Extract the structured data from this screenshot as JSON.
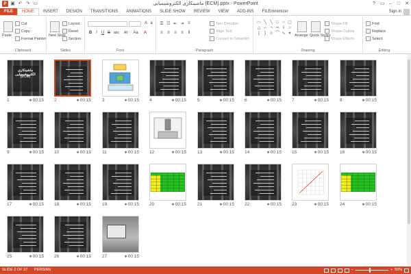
{
  "app": {
    "title": "ماشینکاری الکتروشیمیایی (ECM).pptx - PowerPoint",
    "icon_letter": "P"
  },
  "window": {
    "help": "?",
    "minimize": "–",
    "restore": "□",
    "close": "✕"
  },
  "qat": [
    "save-icon",
    "undo-icon",
    "redo-icon",
    "start-from-beginning-icon"
  ],
  "tabs": [
    {
      "label": "FILE"
    },
    {
      "label": "HOME"
    },
    {
      "label": "INSERT"
    },
    {
      "label": "DESIGN"
    },
    {
      "label": "TRANSITIONS"
    },
    {
      "label": "ANIMATIONS"
    },
    {
      "label": "SLIDE SHOW"
    },
    {
      "label": "REVIEW"
    },
    {
      "label": "VIEW"
    },
    {
      "label": "ADD-INS"
    },
    {
      "label": "FILEminimizer"
    }
  ],
  "account": {
    "signin": "Sign in"
  },
  "ribbon": {
    "clipboard": {
      "label": "Clipboard",
      "paste": "Paste",
      "cut": "Cut",
      "copy": "Copy",
      "format_painter": "Format Painter"
    },
    "slides": {
      "label": "Slides",
      "new_slide": "New Slide",
      "layout": "Layout",
      "reset": "Reset",
      "section": "Section"
    },
    "font": {
      "label": "Font",
      "bold": "B",
      "italic": "I",
      "underline": "U",
      "strike": "S",
      "abc": "abc",
      "av": "AV",
      "aa": "Aa",
      "fontcolor": "A"
    },
    "paragraph": {
      "label": "Paragraph",
      "text_direction": "Text Direction",
      "align_text": "Align Text",
      "convert_smartart": "Convert to SmartArt"
    },
    "drawing": {
      "label": "Drawing",
      "arrange": "Arrange",
      "quick_styles": "Quick Styles",
      "shape_fill": "Shape Fill",
      "shape_outline": "Shape Outline",
      "shape_effects": "Shape Effects"
    },
    "editing": {
      "label": "Editing",
      "find": "Find",
      "replace": "Replace",
      "select": "Select"
    }
  },
  "slides": [
    {
      "num": "1",
      "time": "00:15",
      "kind": "title",
      "title": "ماشینکاری الکتروشیمیایی",
      "subtitle": "(ECM)"
    },
    {
      "num": "2",
      "time": "00:15",
      "kind": "text",
      "selected": true
    },
    {
      "num": "3",
      "time": "00:15",
      "kind": "diagram"
    },
    {
      "num": "4",
      "time": "00:15",
      "kind": "text"
    },
    {
      "num": "5",
      "time": "00:15",
      "kind": "text"
    },
    {
      "num": "6",
      "time": "00:15",
      "kind": "text"
    },
    {
      "num": "7",
      "time": "00:15",
      "kind": "text"
    },
    {
      "num": "8",
      "time": "00:15",
      "kind": "text"
    },
    {
      "num": "9",
      "time": "00:15",
      "kind": "text"
    },
    {
      "num": "10",
      "time": "00:15",
      "kind": "text"
    },
    {
      "num": "11",
      "time": "00:15",
      "kind": "text"
    },
    {
      "num": "12",
      "time": "00:15",
      "kind": "diagram2"
    },
    {
      "num": "13",
      "time": "00:15",
      "kind": "text"
    },
    {
      "num": "14",
      "time": "00:15",
      "kind": "text"
    },
    {
      "num": "15",
      "time": "00:15",
      "kind": "text"
    },
    {
      "num": "16",
      "time": "00:15",
      "kind": "text"
    },
    {
      "num": "17",
      "time": "00:15",
      "kind": "text"
    },
    {
      "num": "18",
      "time": "00:15",
      "kind": "text"
    },
    {
      "num": "19",
      "time": "00:15",
      "kind": "text"
    },
    {
      "num": "20",
      "time": "00:15",
      "kind": "table"
    },
    {
      "num": "21",
      "time": "00:15",
      "kind": "text"
    },
    {
      "num": "22",
      "time": "00:15",
      "kind": "text"
    },
    {
      "num": "23",
      "time": "00:15",
      "kind": "graph"
    },
    {
      "num": "24",
      "time": "00:15",
      "kind": "table"
    },
    {
      "num": "25",
      "time": "00:15",
      "kind": "text"
    },
    {
      "num": "26",
      "time": "00:15",
      "kind": "text"
    },
    {
      "num": "27",
      "time": "00:15",
      "kind": "photo"
    }
  ],
  "status": {
    "slide_info": "SLIDE 2 OF 27",
    "language": "PERSIAN",
    "zoom": "50%"
  },
  "colors": {
    "accent": "#d24726",
    "table_green": "#22c21f",
    "table_yellow": "#f2ef1a"
  }
}
